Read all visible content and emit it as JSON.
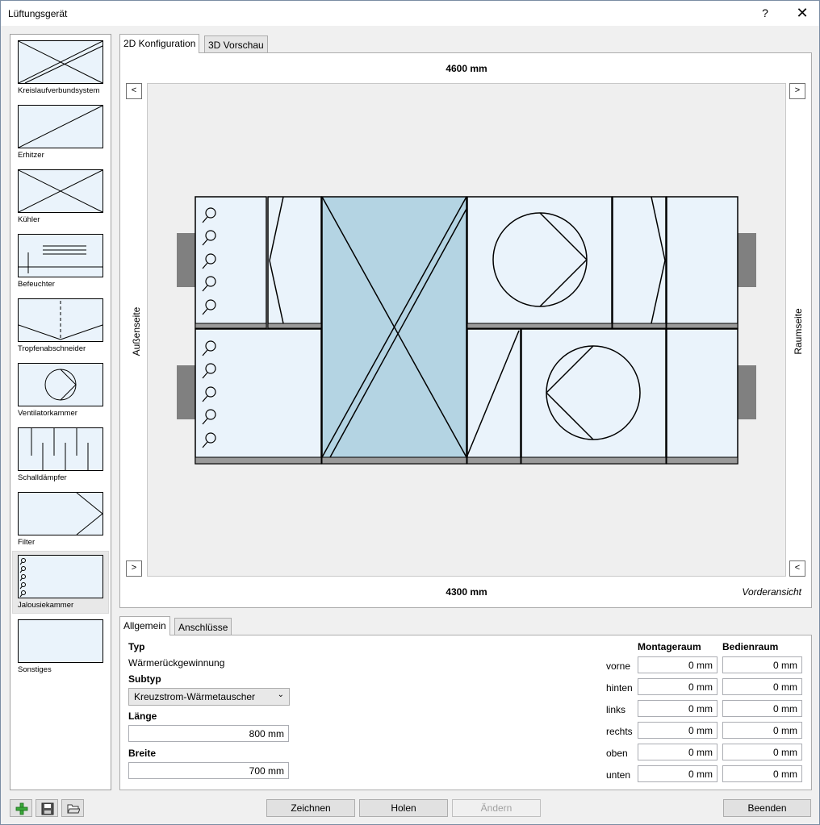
{
  "window": {
    "title": "Lüftungsgerät",
    "help_label": "?",
    "close_label": "✕"
  },
  "palette": {
    "items": [
      {
        "label": "Kreislaufverbundsystem",
        "icon": "cross-double-icon"
      },
      {
        "label": "Erhitzer",
        "icon": "diagonal-icon"
      },
      {
        "label": "Kühler",
        "icon": "cross-icon"
      },
      {
        "label": "Befeuchter",
        "icon": "humidifier-icon"
      },
      {
        "label": "Tropfenabschneider",
        "icon": "droplet-separator-icon"
      },
      {
        "label": "Ventilatorkammer",
        "icon": "fan-icon"
      },
      {
        "label": "Schalldämpfer",
        "icon": "silencer-icon"
      },
      {
        "label": "Filter",
        "icon": "filter-icon"
      },
      {
        "label": "Jalousiekammer",
        "icon": "damper-icon",
        "selected": true
      },
      {
        "label": "Sonstiges",
        "icon": "blank-icon"
      }
    ]
  },
  "config_tabs": [
    {
      "label": "2D Konfiguration",
      "active": true
    },
    {
      "label": "3D Vorschau",
      "active": false
    }
  ],
  "config": {
    "dim_top": "4600 mm",
    "dim_bottom": "4300 mm",
    "view_label": "Vorderansicht",
    "side_left": "Außenseite",
    "side_right": "Raumseite",
    "nav_prev": "<",
    "nav_next": ">"
  },
  "prop_tabs": [
    {
      "label": "Allgemein",
      "active": true
    },
    {
      "label": "Anschlüsse",
      "active": false
    }
  ],
  "props": {
    "typ_label": "Typ",
    "typ_value": "Wärmerückgewinnung",
    "subtyp_label": "Subtyp",
    "subtyp_value": "Kreuzstrom-Wärmetauscher",
    "laenge_label": "Länge",
    "laenge_value": "800 mm",
    "breite_label": "Breite",
    "breite_value": "700 mm"
  },
  "space": {
    "col_montage": "Montageraum",
    "col_bedien": "Bedienraum",
    "rows": [
      {
        "label": "vorne",
        "montage": "0 mm",
        "bedien": "0 mm"
      },
      {
        "label": "hinten",
        "montage": "0 mm",
        "bedien": "0 mm"
      },
      {
        "label": "links",
        "montage": "0 mm",
        "bedien": "0 mm"
      },
      {
        "label": "rechts",
        "montage": "0 mm",
        "bedien": "0 mm"
      },
      {
        "label": "oben",
        "montage": "0 mm",
        "bedien": "0 mm"
      },
      {
        "label": "unten",
        "montage": "0 mm",
        "bedien": "0 mm"
      }
    ]
  },
  "buttons": {
    "zeichnen": "Zeichnen",
    "holen": "Holen",
    "aendern": "Ändern",
    "beenden": "Beenden"
  },
  "colors": {
    "unit_fill": "#eaf3fb",
    "hx_fill": "#b4d4e3",
    "duct": "#808080",
    "canvas_bg": "#efefef"
  }
}
